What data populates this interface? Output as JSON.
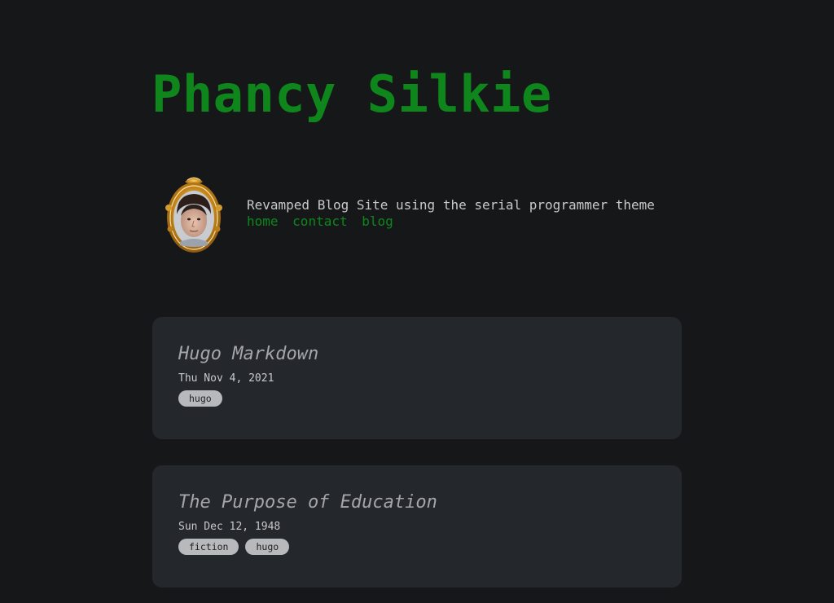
{
  "site": {
    "title": "Phancy Silkie",
    "tagline": "Revamped Blog Site using the serial programmer theme"
  },
  "profile": {
    "image": "framed-portrait-avatar"
  },
  "nav": {
    "items": [
      {
        "label": "home"
      },
      {
        "label": "contact"
      },
      {
        "label": "blog"
      }
    ]
  },
  "posts": [
    {
      "title": "Hugo Markdown",
      "date": "Thu Nov 4, 2021",
      "tags": [
        "hugo"
      ]
    },
    {
      "title": "The Purpose of Education",
      "date": "Sun Dec 12, 1948",
      "tags": [
        "fiction",
        "hugo"
      ]
    }
  ],
  "colors": {
    "background": "#161719",
    "accent": "#0e861c",
    "card": "#24272c",
    "text": "#c8c9cb",
    "tag": "#b7b9bc"
  }
}
